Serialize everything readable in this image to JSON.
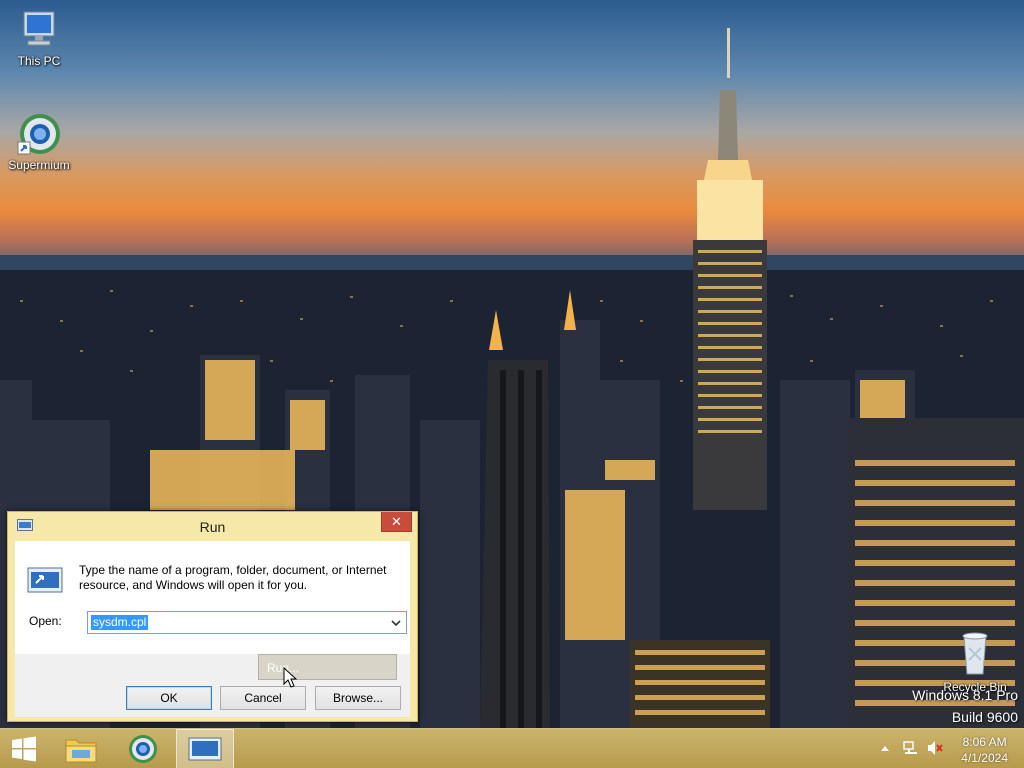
{
  "desktop": {
    "icons": [
      {
        "label": "This PC",
        "icon": "this-pc-icon"
      },
      {
        "label": "Supermium",
        "icon": "supermium-icon"
      },
      {
        "label": "Recycle Bin",
        "icon": "recycle-bin-icon"
      }
    ],
    "watermark": {
      "line1": "Windows 8.1 Pro",
      "line2": "Build 9600"
    }
  },
  "run_dialog": {
    "title": "Run",
    "close_glyph": "✕",
    "description": "Type the name of a program, folder, document, or Internet resource, and Windows will open it for you.",
    "open_label": "Open:",
    "open_value": "sysdm.cpl",
    "buttons": {
      "ok": "OK",
      "cancel": "Cancel",
      "browse": "Browse..."
    },
    "accent": "#f6e8a8",
    "close_color": "#c74c3c"
  },
  "taskbar_tooltip": {
    "label": "Run..."
  },
  "taskbar": {
    "items": [
      "start-icon",
      "file-explorer-icon",
      "supermium-icon",
      "run-icon"
    ],
    "tray_icons": [
      "show-hidden-icons-icon",
      "network-icon",
      "volume-muted-icon"
    ],
    "clock": {
      "time": "8:06 AM",
      "date": "4/1/2024"
    },
    "color": "#c0a557"
  }
}
